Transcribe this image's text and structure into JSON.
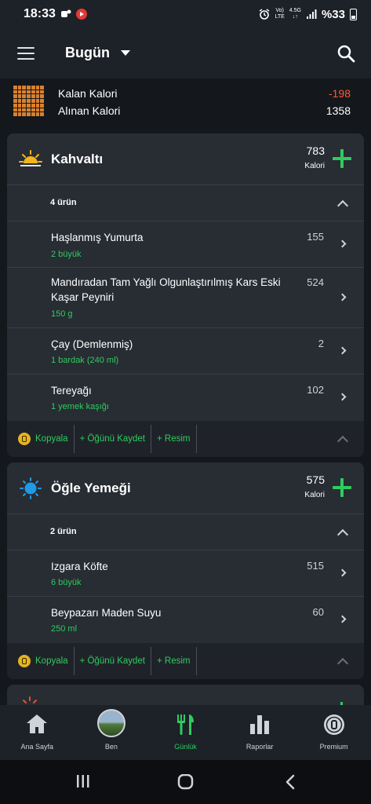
{
  "status_bar": {
    "time": "18:33",
    "network_top": "Vo)",
    "network_bottom": "LTE",
    "net_type": "4.5G",
    "battery": "%33"
  },
  "header": {
    "date_label": "Bugün",
    "menu_icon": "hamburger-icon",
    "search_icon": "search-icon"
  },
  "summary": {
    "remaining_label": "Kalan Kalori",
    "remaining_value": "-198",
    "consumed_label": "Alınan Kalori",
    "consumed_value": "1358"
  },
  "meals": [
    {
      "title": "Kahvaltı",
      "kcal": "783",
      "kcal_unit": "Kalori",
      "count_label": "4 ürün",
      "items": [
        {
          "name": "Haşlanmış Yumurta",
          "qty": "2 büyük",
          "kcal": "155"
        },
        {
          "name": "Mandıradan  Tam Yağlı Olgunlaştırılmış Kars Eski Kaşar Peyniri",
          "qty": "150 g",
          "kcal": "524"
        },
        {
          "name": "Çay (Demlenmiş)",
          "qty": "1 bardak (240 ml)",
          "kcal": "2"
        },
        {
          "name": "Tereyağı",
          "qty": "1 yemek kaşığı",
          "kcal": "102"
        }
      ],
      "actions": {
        "copy": "Kopyala",
        "save": "+ Öğünü Kaydet",
        "photo": "+ Resim"
      }
    },
    {
      "title": "Öğle Yemeği",
      "kcal": "575",
      "kcal_unit": "Kalori",
      "count_label": "2 ürün",
      "items": [
        {
          "name": "Izgara Köfte",
          "qty": "6 büyük",
          "kcal": "515"
        },
        {
          "name": "Beypazarı Maden Suyu",
          "qty": "250 ml",
          "kcal": "60"
        }
      ],
      "actions": {
        "copy": "Kopyala",
        "save": "+ Öğünü Kaydet",
        "photo": "+ Resim"
      }
    }
  ],
  "bottom_nav": [
    {
      "label": "Ana Sayfa",
      "icon": "home-icon"
    },
    {
      "label": "Ben",
      "icon": "avatar"
    },
    {
      "label": "Günlük",
      "icon": "utensils-icon"
    },
    {
      "label": "Raporlar",
      "icon": "bar-chart-icon"
    },
    {
      "label": "Premium",
      "icon": "premium-lock-icon"
    }
  ],
  "colors": {
    "accent_green": "#2ecc5f",
    "negative_red": "#ff5a36",
    "card_bg": "#282c33",
    "page_bg": "#14171c"
  }
}
